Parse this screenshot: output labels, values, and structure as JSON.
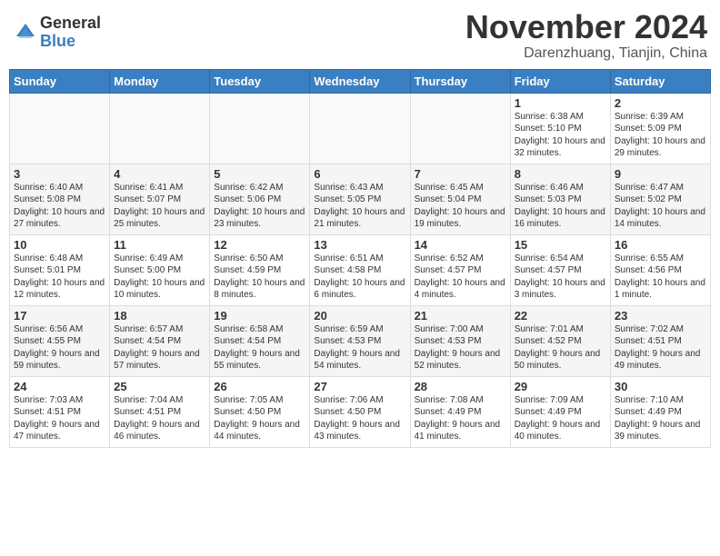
{
  "header": {
    "logo_general": "General",
    "logo_blue": "Blue",
    "month": "November 2024",
    "location": "Darenzhuang, Tianjin, China"
  },
  "weekdays": [
    "Sunday",
    "Monday",
    "Tuesday",
    "Wednesday",
    "Thursday",
    "Friday",
    "Saturday"
  ],
  "weeks": [
    {
      "shade": false,
      "days": [
        {
          "num": "",
          "info": ""
        },
        {
          "num": "",
          "info": ""
        },
        {
          "num": "",
          "info": ""
        },
        {
          "num": "",
          "info": ""
        },
        {
          "num": "",
          "info": ""
        },
        {
          "num": "1",
          "info": "Sunrise: 6:38 AM\nSunset: 5:10 PM\nDaylight: 10 hours and 32 minutes."
        },
        {
          "num": "2",
          "info": "Sunrise: 6:39 AM\nSunset: 5:09 PM\nDaylight: 10 hours and 29 minutes."
        }
      ]
    },
    {
      "shade": true,
      "days": [
        {
          "num": "3",
          "info": "Sunrise: 6:40 AM\nSunset: 5:08 PM\nDaylight: 10 hours and 27 minutes."
        },
        {
          "num": "4",
          "info": "Sunrise: 6:41 AM\nSunset: 5:07 PM\nDaylight: 10 hours and 25 minutes."
        },
        {
          "num": "5",
          "info": "Sunrise: 6:42 AM\nSunset: 5:06 PM\nDaylight: 10 hours and 23 minutes."
        },
        {
          "num": "6",
          "info": "Sunrise: 6:43 AM\nSunset: 5:05 PM\nDaylight: 10 hours and 21 minutes."
        },
        {
          "num": "7",
          "info": "Sunrise: 6:45 AM\nSunset: 5:04 PM\nDaylight: 10 hours and 19 minutes."
        },
        {
          "num": "8",
          "info": "Sunrise: 6:46 AM\nSunset: 5:03 PM\nDaylight: 10 hours and 16 minutes."
        },
        {
          "num": "9",
          "info": "Sunrise: 6:47 AM\nSunset: 5:02 PM\nDaylight: 10 hours and 14 minutes."
        }
      ]
    },
    {
      "shade": false,
      "days": [
        {
          "num": "10",
          "info": "Sunrise: 6:48 AM\nSunset: 5:01 PM\nDaylight: 10 hours and 12 minutes."
        },
        {
          "num": "11",
          "info": "Sunrise: 6:49 AM\nSunset: 5:00 PM\nDaylight: 10 hours and 10 minutes."
        },
        {
          "num": "12",
          "info": "Sunrise: 6:50 AM\nSunset: 4:59 PM\nDaylight: 10 hours and 8 minutes."
        },
        {
          "num": "13",
          "info": "Sunrise: 6:51 AM\nSunset: 4:58 PM\nDaylight: 10 hours and 6 minutes."
        },
        {
          "num": "14",
          "info": "Sunrise: 6:52 AM\nSunset: 4:57 PM\nDaylight: 10 hours and 4 minutes."
        },
        {
          "num": "15",
          "info": "Sunrise: 6:54 AM\nSunset: 4:57 PM\nDaylight: 10 hours and 3 minutes."
        },
        {
          "num": "16",
          "info": "Sunrise: 6:55 AM\nSunset: 4:56 PM\nDaylight: 10 hours and 1 minute."
        }
      ]
    },
    {
      "shade": true,
      "days": [
        {
          "num": "17",
          "info": "Sunrise: 6:56 AM\nSunset: 4:55 PM\nDaylight: 9 hours and 59 minutes."
        },
        {
          "num": "18",
          "info": "Sunrise: 6:57 AM\nSunset: 4:54 PM\nDaylight: 9 hours and 57 minutes."
        },
        {
          "num": "19",
          "info": "Sunrise: 6:58 AM\nSunset: 4:54 PM\nDaylight: 9 hours and 55 minutes."
        },
        {
          "num": "20",
          "info": "Sunrise: 6:59 AM\nSunset: 4:53 PM\nDaylight: 9 hours and 54 minutes."
        },
        {
          "num": "21",
          "info": "Sunrise: 7:00 AM\nSunset: 4:53 PM\nDaylight: 9 hours and 52 minutes."
        },
        {
          "num": "22",
          "info": "Sunrise: 7:01 AM\nSunset: 4:52 PM\nDaylight: 9 hours and 50 minutes."
        },
        {
          "num": "23",
          "info": "Sunrise: 7:02 AM\nSunset: 4:51 PM\nDaylight: 9 hours and 49 minutes."
        }
      ]
    },
    {
      "shade": false,
      "days": [
        {
          "num": "24",
          "info": "Sunrise: 7:03 AM\nSunset: 4:51 PM\nDaylight: 9 hours and 47 minutes."
        },
        {
          "num": "25",
          "info": "Sunrise: 7:04 AM\nSunset: 4:51 PM\nDaylight: 9 hours and 46 minutes."
        },
        {
          "num": "26",
          "info": "Sunrise: 7:05 AM\nSunset: 4:50 PM\nDaylight: 9 hours and 44 minutes."
        },
        {
          "num": "27",
          "info": "Sunrise: 7:06 AM\nSunset: 4:50 PM\nDaylight: 9 hours and 43 minutes."
        },
        {
          "num": "28",
          "info": "Sunrise: 7:08 AM\nSunset: 4:49 PM\nDaylight: 9 hours and 41 minutes."
        },
        {
          "num": "29",
          "info": "Sunrise: 7:09 AM\nSunset: 4:49 PM\nDaylight: 9 hours and 40 minutes."
        },
        {
          "num": "30",
          "info": "Sunrise: 7:10 AM\nSunset: 4:49 PM\nDaylight: 9 hours and 39 minutes."
        }
      ]
    }
  ]
}
